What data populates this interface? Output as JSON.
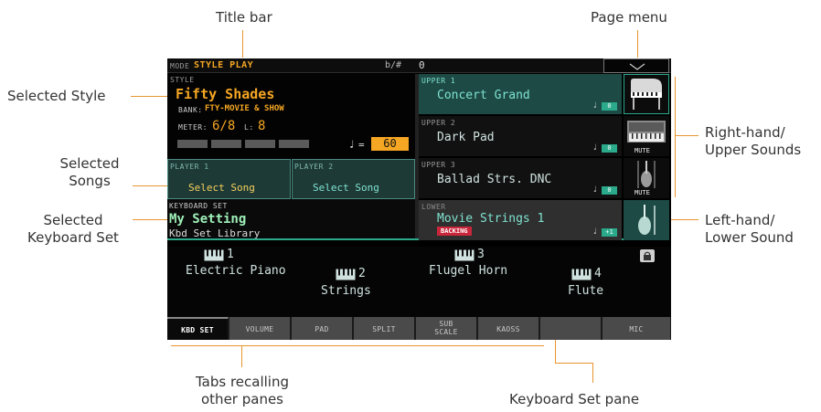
{
  "annotations": {
    "title_bar": "Title bar",
    "page_menu": "Page menu",
    "selected_style": "Selected Style",
    "selected_songs": [
      "Selected",
      "Songs"
    ],
    "selected_kbd_set": [
      "Selected",
      "Keyboard Set"
    ],
    "right_hand": [
      "Right-hand/",
      "Upper Sounds"
    ],
    "left_hand": [
      "Left-hand/",
      "Lower Sound"
    ],
    "tabs_recalling": [
      "Tabs recalling",
      "other panes"
    ],
    "kbd_set_pane": "Keyboard Set pane"
  },
  "titlebar": {
    "mode_label": "MODE",
    "mode_value": "STYLE PLAY",
    "transpose_label": "b/#",
    "transpose_value": "0"
  },
  "style": {
    "label": "STYLE",
    "name": "Fifty Shades",
    "bank_label": "BANK:",
    "bank_value": "FTY-MOVIE & SHOW",
    "meter_label": "METER:",
    "meter_value": "6/8",
    "l_label": "L:",
    "l_value": "8",
    "tempo_eq": "=",
    "tempo_value": "60"
  },
  "players": [
    {
      "label": "PLAYER 1",
      "value": "Select Song"
    },
    {
      "label": "PLAYER 2",
      "value": "Select Song"
    }
  ],
  "keyboard_set": {
    "label": "KEYBOARD SET",
    "name": "My Setting",
    "library": "Kbd Set Library"
  },
  "sounds": [
    {
      "label": "UPPER 1",
      "name": "Concert Grand",
      "octave": "0",
      "icon": "grand-piano-icon"
    },
    {
      "label": "UPPER 2",
      "name": "Dark Pad",
      "octave": "0",
      "icon": "synth-pad-icon",
      "mute": "MUTE"
    },
    {
      "label": "UPPER 3",
      "name": "Ballad Strs. DNC",
      "octave": "0",
      "icon": "violin-icon",
      "mute": "MUTE"
    },
    {
      "label": "LOWER",
      "name": "Movie Strings 1",
      "octave": "+1",
      "icon": "violin-icon",
      "badge": "BACKING"
    }
  ],
  "kbd_pane": [
    {
      "num": "1",
      "name": "Electric Piano"
    },
    {
      "num": "2",
      "name": "Strings"
    },
    {
      "num": "3",
      "name": "Flugel Horn"
    },
    {
      "num": "4",
      "name": "Flute"
    }
  ],
  "tabs": [
    "KBD SET",
    "VOLUME",
    "PAD",
    "SPLIT",
    "SUB",
    "SCALE",
    "KAOSS",
    "",
    "MIC"
  ],
  "colors": {
    "accent": "#f5a623",
    "teal": "#2aa98b",
    "leader": "#e8952f"
  }
}
